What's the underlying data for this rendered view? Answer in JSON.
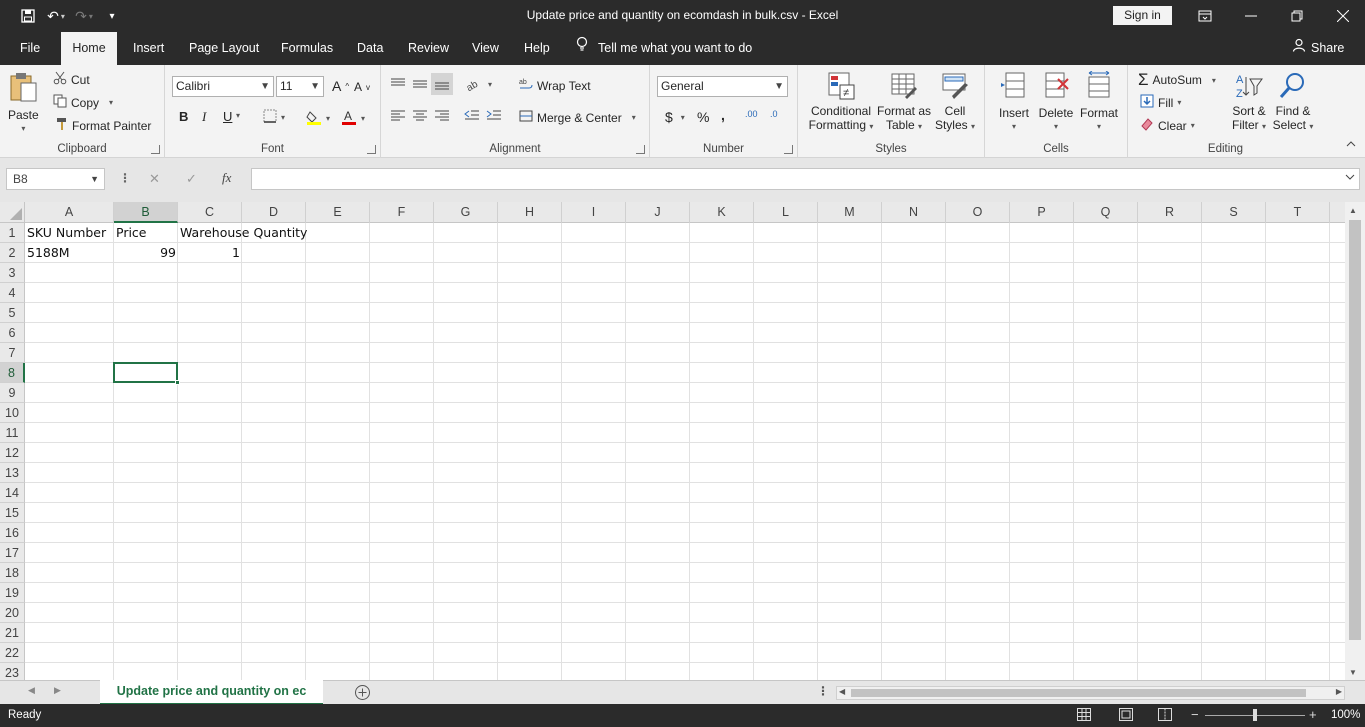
{
  "window": {
    "title": "Update price and quantity on ecomdash in bulk.csv  -  Excel",
    "sign_in": "Sign in"
  },
  "tabs": [
    "File",
    "Home",
    "Insert",
    "Page Layout",
    "Formulas",
    "Data",
    "Review",
    "View",
    "Help"
  ],
  "active_tab": "Home",
  "tell_me": "Tell me what you want to do",
  "share": "Share",
  "ribbon": {
    "clipboard": {
      "label": "Clipboard",
      "paste": "Paste",
      "cut": "Cut",
      "copy": "Copy",
      "format_painter": "Format Painter"
    },
    "font": {
      "label": "Font",
      "font_name": "Calibri",
      "font_size": "11",
      "bold": "B",
      "italic": "I",
      "underline": "U"
    },
    "alignment": {
      "label": "Alignment",
      "wrap_text": "Wrap Text",
      "merge_center": "Merge & Center"
    },
    "number": {
      "label": "Number",
      "format": "General",
      "currency": "$",
      "percent": "%",
      "comma": ",",
      "inc_decimal": ".00",
      "dec_decimal": ".0"
    },
    "styles": {
      "label": "Styles",
      "conditional_1": "Conditional",
      "conditional_2": "Formatting",
      "format_as_1": "Format as",
      "format_as_2": "Table",
      "cell_1": "Cell",
      "cell_2": "Styles"
    },
    "cells": {
      "label": "Cells",
      "insert": "Insert",
      "delete": "Delete",
      "format": "Format"
    },
    "editing": {
      "label": "Editing",
      "autosum": "AutoSum",
      "fill": "Fill",
      "clear": "Clear",
      "sort_1": "Sort &",
      "sort_2": "Filter",
      "find_1": "Find &",
      "find_2": "Select"
    }
  },
  "formula_bar": {
    "name_box": "B8",
    "cancel": "✕",
    "enter": "✓",
    "fx": "fx",
    "value": ""
  },
  "columns": [
    "A",
    "B",
    "C",
    "D",
    "E",
    "F",
    "G",
    "H",
    "I",
    "J",
    "K",
    "L",
    "M",
    "N",
    "O",
    "P",
    "Q",
    "R",
    "S",
    "T"
  ],
  "rows": [
    "1",
    "2",
    "3",
    "4",
    "5",
    "6",
    "7",
    "8",
    "9",
    "10",
    "11",
    "12",
    "13",
    "14",
    "15",
    "16",
    "17",
    "18",
    "19",
    "20",
    "21",
    "22",
    "23"
  ],
  "cells": {
    "A1": "SKU Number",
    "B1": "Price",
    "C1": "Warehouse Quantity",
    "A2": "5188M",
    "B2": "99",
    "C2": "1"
  },
  "selected_cell": "B8",
  "sheet": {
    "tab_name": "Update price and quantity on ec"
  },
  "status": {
    "mode": "Ready",
    "zoom": "100%"
  },
  "colors": {
    "accent": "#217346",
    "chrome": "#2b2b2b",
    "ribbon": "#f3f3f3"
  }
}
